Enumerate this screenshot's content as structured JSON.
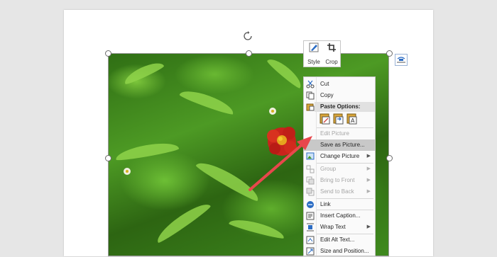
{
  "mini_toolbar": {
    "style_label": "Style",
    "crop_label": "Crop"
  },
  "context_menu": {
    "cut": "Cut",
    "copy": "Copy",
    "paste_options": "Paste Options:",
    "edit_picture": "Edit Picture",
    "save_as_picture": "Save as Picture...",
    "change_picture": "Change Picture",
    "group": "Group",
    "bring_to_front": "Bring to Front",
    "send_to_back": "Send to Back",
    "link": "Link",
    "insert_caption": "Insert Caption...",
    "wrap_text": "Wrap Text",
    "edit_alt_text": "Edit Alt Text...",
    "size_and_position": "Size and Position..."
  },
  "colors": {
    "highlight": "#c8c8c8",
    "annotation_arrow": "#e8474c",
    "accent_blue": "#2b6cc4"
  },
  "icons": [
    "cut-icon",
    "copy-icon",
    "paste-icon",
    "style-icon",
    "crop-icon",
    "rotate-icon",
    "layout-options-icon",
    "link-icon",
    "caption-icon",
    "wrap-text-icon",
    "alt-text-icon",
    "size-position-icon"
  ]
}
